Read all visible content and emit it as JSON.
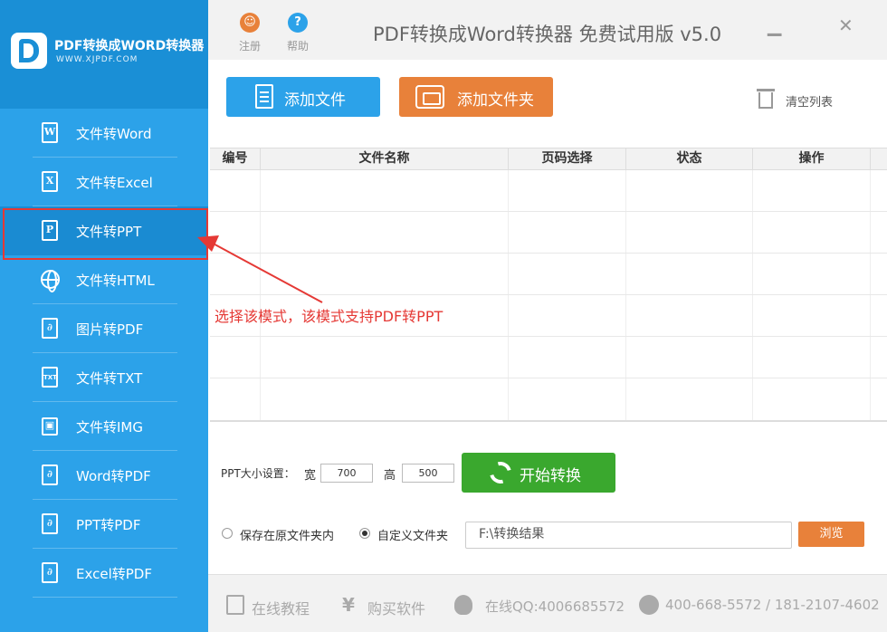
{
  "app": {
    "logo_title": "PDF转换成WORD转换器",
    "logo_url": "WWW.XJPDF.COM",
    "window_title": "PDF转换成Word转换器 免费试用版 v5.0",
    "register_label": "注册",
    "help_label": "帮助",
    "minimize_glyph": "▁",
    "close_glyph": "✕"
  },
  "sidebar": {
    "items": [
      {
        "label": "文件转Word",
        "icon": "word-doc-icon",
        "glyph": "W"
      },
      {
        "label": "文件转Excel",
        "icon": "excel-doc-icon",
        "glyph": "X"
      },
      {
        "label": "文件转PPT",
        "icon": "ppt-doc-icon",
        "glyph": "P",
        "active": true
      },
      {
        "label": "文件转HTML",
        "icon": "globe-icon",
        "glyph": ""
      },
      {
        "label": "图片转PDF",
        "icon": "pdf-doc-icon",
        "glyph": "∂"
      },
      {
        "label": "文件转TXT",
        "icon": "txt-doc-icon",
        "glyph": "TXT"
      },
      {
        "label": "文件转IMG",
        "icon": "image-icon",
        "glyph": "▣"
      },
      {
        "label": "Word转PDF",
        "icon": "pdf-doc-icon",
        "glyph": "∂"
      },
      {
        "label": "PPT转PDF",
        "icon": "pdf-doc-icon",
        "glyph": "∂"
      },
      {
        "label": "Excel转PDF",
        "icon": "pdf-doc-icon",
        "glyph": "∂"
      }
    ]
  },
  "toolbar": {
    "add_file_label": "添加文件",
    "add_folder_label": "添加文件夹",
    "clear_list_label": "清空列表"
  },
  "table": {
    "columns": [
      "编号",
      "文件名称",
      "页码选择",
      "状态",
      "操作"
    ],
    "rows": []
  },
  "annotation": {
    "text": "选择该模式，该模式支持PDF转PPT",
    "color": "#e53935"
  },
  "settings": {
    "ppt_size_label": "PPT大小设置：",
    "width_label": "宽",
    "width_value": "700",
    "height_label": "高",
    "height_value": "500",
    "start_label": "开始转换",
    "save_original_label": "保存在原文件夹内",
    "custom_folder_label": "自定义文件夹",
    "selected_option": "custom_folder",
    "output_path": "F:\\转换结果",
    "browse_label": "浏览"
  },
  "footer": {
    "tutorial_label": "在线教程",
    "buy_label": "购买软件",
    "yen_glyph": "¥",
    "qq_label": "在线QQ:4006685572",
    "phone_label": "400-668-5572 / 181-2107-4602"
  },
  "colors": {
    "sidebar_blue": "#2ca2e9",
    "active_blue": "#1a8bd2",
    "orange": "#e8813a",
    "green": "#3aa82e",
    "highlight_red": "#e53935"
  }
}
